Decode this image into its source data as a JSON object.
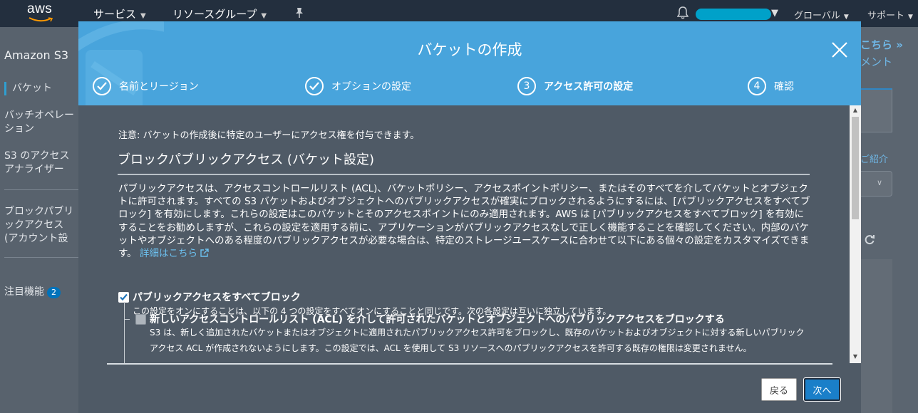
{
  "topnav": {
    "logo_text": "aws",
    "services_label": "サービス",
    "resource_groups_label": "リソースグループ",
    "region_label": "グローバル",
    "support_label": "サポート"
  },
  "sidebar": {
    "title": "Amazon S3",
    "items": [
      {
        "label": "バケット"
      },
      {
        "label": "バッチオペレーション"
      },
      {
        "label": "S3 のアクセスアナライザー"
      },
      {
        "label": "ブロックパブリックアクセス (アカウント設定)"
      },
      {
        "label": "注目機能",
        "badge": "2"
      }
    ]
  },
  "background_right": {
    "text1": "こちら »",
    "text2": "メント",
    "text3": "ご紹介"
  },
  "modal": {
    "title": "バケットの作成",
    "steps": [
      {
        "marker": "check",
        "label": "名前とリージョン"
      },
      {
        "marker": "check",
        "label": "オプションの設定"
      },
      {
        "marker": "3",
        "label": "アクセス許可の設定"
      },
      {
        "marker": "4",
        "label": "確認"
      }
    ],
    "note": "注意: バケットの作成後に特定のユーザーにアクセス権を付与できます。",
    "section_title": "ブロックパブリックアクセス (バケット設定)",
    "description": "パブリックアクセスは、アクセスコントロールリスト (ACL)、バケットポリシー、アクセスポイントポリシー、またはそのすべてを介してバケットとオブジェクトに許可されます。すべての S3 バケットおよびオブジェクトへのパブリックアクセスが確実にブロックされるようにするには、[パブリックアクセスをすべてブロック] を有効にします。これらの設定はこのバケットとそのアクセスポイントにのみ適用されます。AWS は [パブリックアクセスをすべてブロック] を有効にすることをお勧めしますが、これらの設定を適用する前に、アプリケーションがパブリックアクセスなしで正しく機能することを確認してください。内部のバケットやオブジェクトへのある程度のパブリックアクセスが必要な場合は、特定のストレージユースケースに合わせて以下にある個々の設定をカスタマイズできます。",
    "learn_more": "詳細はこちら",
    "block_all": {
      "label": "パブリックアクセスをすべてブロック",
      "checked": true,
      "description": "この設定をオンにすることは、以下の 4 つの設定をすべてオンにすることと同じです。次の各設定は互いに独立しています。"
    },
    "block_new_acl": {
      "label": "新しいアクセスコントロールリスト (ACL) を介して許可されたバケットとオブジェクトへのパブリックアクセスをブロックする",
      "checked": false,
      "description_line1": "S3 は、新しく追加されたバケットまたはオブジェクトに適用されたパブリックアクセス許可をブロックし、既存のバケットおよびオブジェクトに対する新しいパブリック",
      "description_line2": "アクセス ACL が作成されないようにします。この設定では、ACL を使用して S3 リソースへのパブリックアクセスを許可する既存の権限は変更されません。"
    },
    "back_label": "戻る",
    "next_label": "次へ"
  },
  "colors": {
    "header_blue": "#48a4dc",
    "modal_body": "#4f5a66",
    "nav_dark": "#232f3e",
    "link": "#6cc1f0",
    "primary_button": "#1a7fc9"
  }
}
